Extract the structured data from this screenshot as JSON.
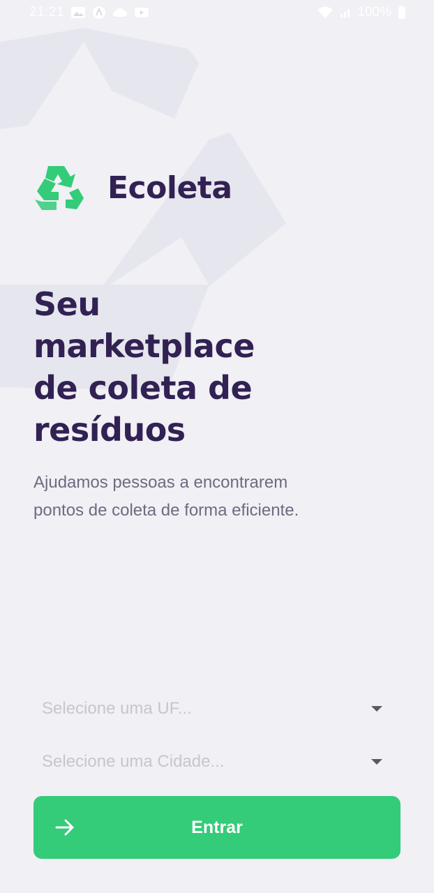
{
  "status_bar": {
    "time": "21:21",
    "battery_percent": "100%",
    "left_icons": [
      "photo-icon",
      "a-circle-icon",
      "cloud-icon",
      "youtube-icon"
    ],
    "right_icons": [
      "wifi-icon",
      "signal-icon",
      "battery-icon"
    ]
  },
  "brand": {
    "name": "Ecoleta",
    "logo_icon": "recycle-icon",
    "logo_color": "#34CB79"
  },
  "hero": {
    "title": "Seu marketplace de coleta de resíduos",
    "description": "Ajudamos pessoas a encontrarem pontos de coleta de forma eficiente."
  },
  "form": {
    "uf_select": {
      "placeholder": "Selecione uma UF..."
    },
    "city_select": {
      "placeholder": "Selecione uma Cidade..."
    },
    "enter_button": {
      "label": "Entrar",
      "icon": "arrow-right-icon"
    }
  },
  "colors": {
    "background": "#F0F0F5",
    "title": "#322153",
    "text": "#6C6C80",
    "primary": "#34CB79",
    "placeholder": "#C6C6CE"
  }
}
